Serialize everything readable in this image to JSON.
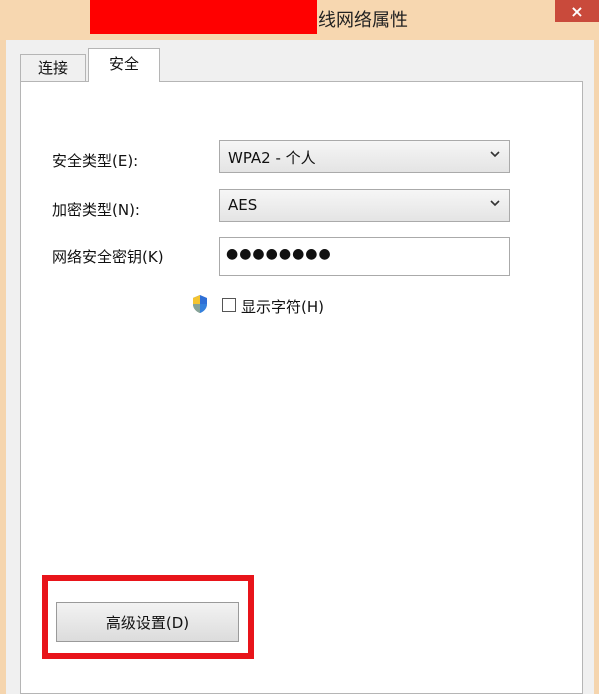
{
  "window": {
    "title": "线网络属性",
    "close_symbol": "×"
  },
  "tabs": [
    {
      "label": "连接"
    },
    {
      "label": "安全"
    }
  ],
  "security": {
    "security_type_label": "安全类型(E):",
    "security_type_value": "WPA2 - 个人",
    "encryption_type_label": "加密类型(N):",
    "encryption_type_value": "AES",
    "network_key_label": "网络安全密钥(K)",
    "network_key_value": "●●●●●●●●",
    "show_chars_label": "显示字符(H)",
    "show_chars_checked": false
  },
  "advanced_button_label": "高级设置(D)",
  "colors": {
    "redaction": "#ff0000",
    "highlight_box": "#e8141a",
    "title_bar": "#f7d7b0"
  }
}
